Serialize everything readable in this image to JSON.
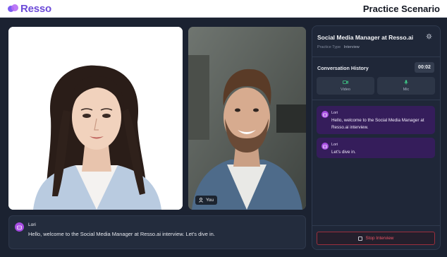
{
  "brand": {
    "name": "Resso"
  },
  "header": {
    "title": "Practice Scenario"
  },
  "video": {
    "self_label": "You"
  },
  "caption": {
    "speaker": "Lori",
    "text": "Hello, welcome to the Social Media Manager at Resso.ai interview. Let's dive in."
  },
  "panel": {
    "title": "Social Media Manager at Resso.ai",
    "practice_type_label": "Practice Type",
    "practice_type_value": "Interview",
    "history_label": "Conversation History",
    "timer": "00:02",
    "controls": {
      "video_label": "Video",
      "mic_label": "Mic"
    },
    "messages": [
      {
        "speaker": "Lori",
        "text": "Hello, welcome to the Social Media Manager at Resso.ai interview."
      },
      {
        "speaker": "Lori",
        "text": "Let's dive in."
      }
    ],
    "stop_label": "Stop Interview"
  },
  "colors": {
    "brand_purple": "#6d4bd8",
    "background": "#1b2231",
    "message_bg": "#351d5b",
    "stop_red": "#ee5566",
    "control_green": "#3fd08a"
  },
  "icons": [
    "settings-gear-icon",
    "camera-icon",
    "microphone-icon",
    "person-icon",
    "stop-square-icon",
    "robot-avatar-icon"
  ]
}
